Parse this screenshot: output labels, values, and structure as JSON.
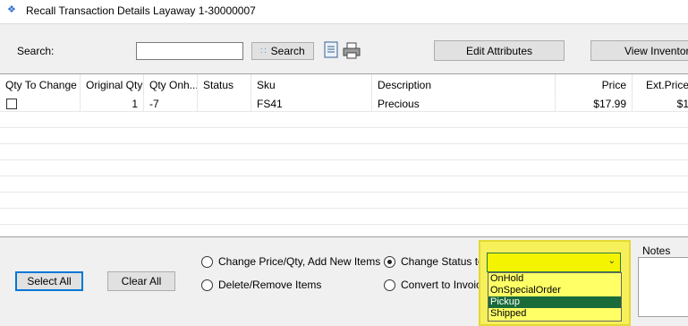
{
  "window": {
    "title": "Recall Transaction Details Layaway 1-30000007"
  },
  "toolbar": {
    "search_label": "Search:",
    "search_value": "",
    "search_button": "Search",
    "edit_attributes_button": "Edit Attributes",
    "view_inventory_button": "View Inventory"
  },
  "grid": {
    "columns": [
      "Qty To Change",
      "Original Qty",
      "Qty Onh...",
      "Status",
      "Sku",
      "Description",
      "Price",
      "Ext.Price"
    ],
    "rows": [
      {
        "qty_to_change_checked": false,
        "original_qty": "1",
        "qty_onhand": "-7",
        "status": "",
        "sku": "FS41",
        "description": "Precious",
        "price": "$17.99",
        "ext_price": "$1"
      }
    ]
  },
  "actions": {
    "select_all": "Select All",
    "clear_all": "Clear All",
    "change_price_qty": "Change Price/Qty, Add New Items",
    "delete_remove": "Delete/Remove Items",
    "change_status_to": "Change Status to:",
    "convert_to_invoice": "Convert to Invoice",
    "selected_option": "change_status"
  },
  "status_dropdown": {
    "value": "",
    "options": [
      "OnHold",
      "OnSpecialOrder",
      "Pickup",
      "Shipped"
    ],
    "highlighted": "Pickup"
  },
  "notes": {
    "label": "Notes",
    "value": ""
  },
  "colors": {
    "highlight_panel": "#f6f05a",
    "dropdown_bg": "#ffff66",
    "selected_option_bg": "#1a6b3a"
  }
}
